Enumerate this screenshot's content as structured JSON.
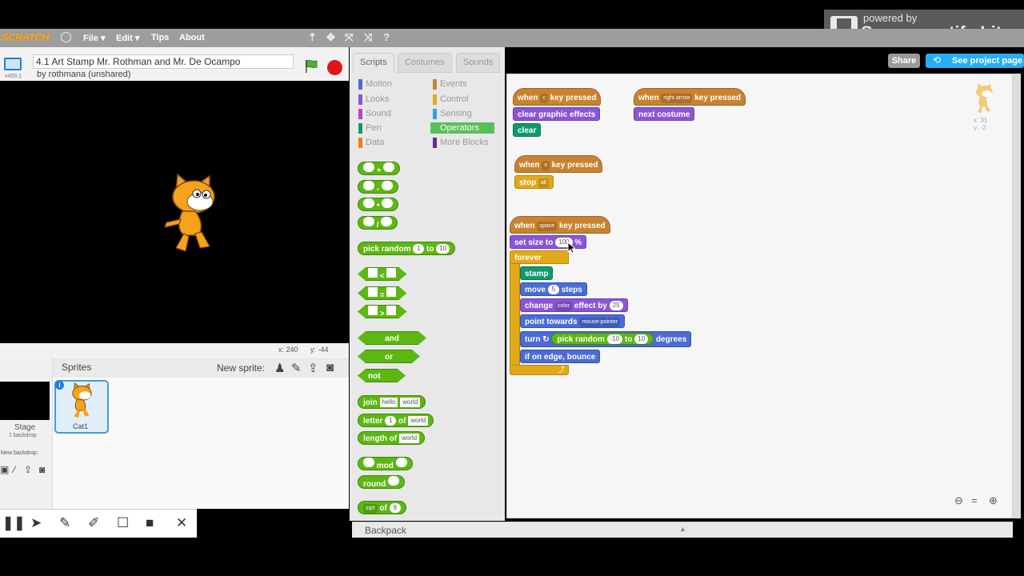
{
  "menubar": {
    "logo": "SCRATCH",
    "file": "File ▾",
    "edit": "Edit ▾",
    "tips": "Tips",
    "about": "About"
  },
  "overlay": {
    "powered": "powered by",
    "name": "Screencastify Lite"
  },
  "project": {
    "title": "4.1 Art Stamp Mr. Rothman and Mr. De Ocampo",
    "version": "v459.1",
    "author": "by rothmana (unshared)"
  },
  "stage": {
    "x_label": "x: 240",
    "y_label": "y: -44"
  },
  "sprites": {
    "header": "Sprites",
    "new_sprite": "New sprite:",
    "stage_label": "Stage",
    "backdrop_count": "1 backdrop",
    "new_backdrop": "New backdrop:",
    "sprite_name": "Cat1"
  },
  "tabs": [
    "Scripts",
    "Costumes",
    "Sounds"
  ],
  "categories": {
    "left": [
      {
        "label": "Motion",
        "color": "#4a6cd4"
      },
      {
        "label": "Looks",
        "color": "#8a55d7"
      },
      {
        "label": "Sound",
        "color": "#bb42c3"
      },
      {
        "label": "Pen",
        "color": "#0e9a6c"
      },
      {
        "label": "Data",
        "color": "#ee7d16"
      }
    ],
    "right": [
      {
        "label": "Events",
        "color": "#c88330"
      },
      {
        "label": "Control",
        "color": "#e1a91a"
      },
      {
        "label": "Sensing",
        "color": "#2ca5e2"
      },
      {
        "label": "Operators",
        "color": "#59c059"
      },
      {
        "label": "More Blocks",
        "color": "#632d99"
      }
    ]
  },
  "palette": {
    "ops": [
      "+",
      "-",
      "*",
      "/"
    ],
    "pick_random": "pick random",
    "pr_from": "1",
    "pr_to_word": "to",
    "pr_to": "10",
    "compare": [
      "<",
      "=",
      ">"
    ],
    "and": "and",
    "or": "or",
    "not": "not",
    "join": "join",
    "join_a": "hello",
    "join_b": "world",
    "letter": "letter",
    "letter_n": "1",
    "of": "of",
    "letter_word": "world",
    "length_of": "length of",
    "length_word": "world",
    "mod": "mod",
    "round": "round",
    "sqrt": "sqrt",
    "sqrt_of": "of",
    "sqrt_val": "9"
  },
  "scripts": {
    "s1_when": "when",
    "s1_key": "c",
    "s1_pressed": "key pressed",
    "s1_b1": "clear graphic effects",
    "s1_b2": "clear",
    "s2_when": "when",
    "s2_key": "right arrow",
    "s2_pressed": "key pressed",
    "s2_b1": "next costume",
    "s3_when": "when",
    "s3_key": "s",
    "s3_pressed": "key pressed",
    "s3_stop": "stop",
    "s3_all": "all",
    "s4_when": "when",
    "s4_key": "space",
    "s4_pressed": "key pressed",
    "s4_setsize": "set size to",
    "s4_size": "100",
    "s4_pct": "%",
    "s4_forever": "forever",
    "s4_stamp": "stamp",
    "s4_move": "move",
    "s4_move_n": "5",
    "s4_steps": "steps",
    "s4_change": "change",
    "s4_color": "color",
    "s4_effect_by": "effect by",
    "s4_effect_n": "25",
    "s4_point": "point towards",
    "s4_target": "mouse-pointer",
    "s4_turn": "turn ↻",
    "s4_pick": "pick random",
    "s4_from": "-10",
    "s4_to": "to",
    "s4_tov": "10",
    "s4_degrees": "degrees",
    "s4_bounce": "if on edge, bounce"
  },
  "topright": {
    "share": "Share",
    "see_project": "See project page"
  },
  "sprite_info": {
    "x": "x: 31",
    "y": "y: -2"
  },
  "backpack": "Backpack"
}
